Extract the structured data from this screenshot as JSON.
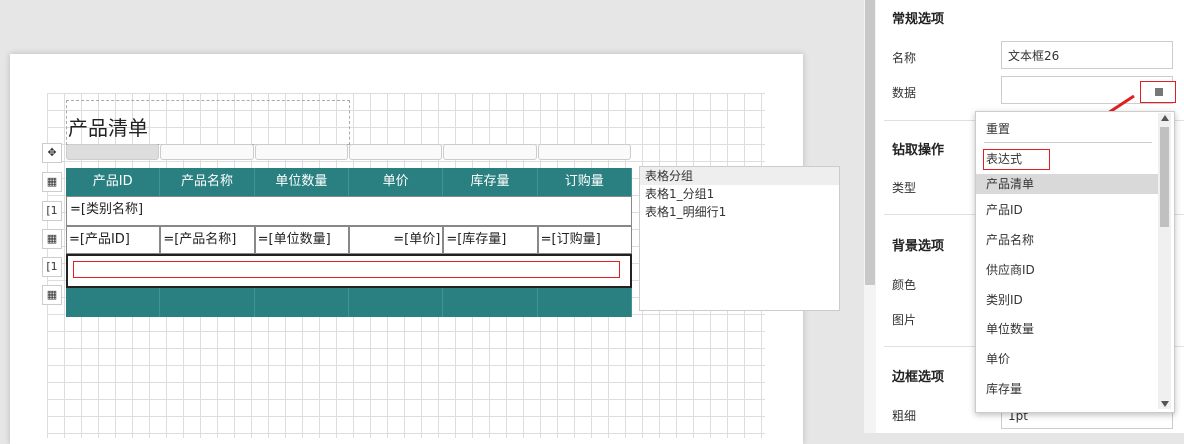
{
  "designer": {
    "title": "产品清单",
    "table_headers": [
      "产品ID",
      "产品名称",
      "单位数量",
      "单价",
      "库存量",
      "订购量"
    ],
    "group_row": "=[类别名称]",
    "detail_cells": [
      "=[产品ID]",
      "=[产品名称]",
      "=[单位数量]",
      "=[单价]",
      "=[库存量]",
      "=[订购量]"
    ],
    "row_icons": [
      "✥",
      "▦",
      "[1",
      "▦",
      "[1",
      "▦"
    ],
    "tree_items": [
      "表格分组",
      "表格1_分组1",
      "表格1_明细行1"
    ],
    "colors": {
      "header_bg": "#2a8080",
      "highlight": "#e02020"
    }
  },
  "panel": {
    "general_title": "常规选项",
    "name_label": "名称",
    "name_value": "文本框26",
    "data_label": "数据",
    "drill_title": "钻取操作",
    "type_label": "类型",
    "bg_title": "背景选项",
    "color_label": "颜色",
    "image_label": "图片",
    "border_title": "边框选项",
    "thickness_label": "粗细",
    "thickness_value": "1pt"
  },
  "dropdown": {
    "items": [
      "重置",
      "表达式",
      "产品清单",
      "产品ID",
      "产品名称",
      "供应商ID",
      "类别ID",
      "单位数量",
      "单价",
      "库存量"
    ],
    "active_index": 2,
    "highlighted_index": 1
  }
}
